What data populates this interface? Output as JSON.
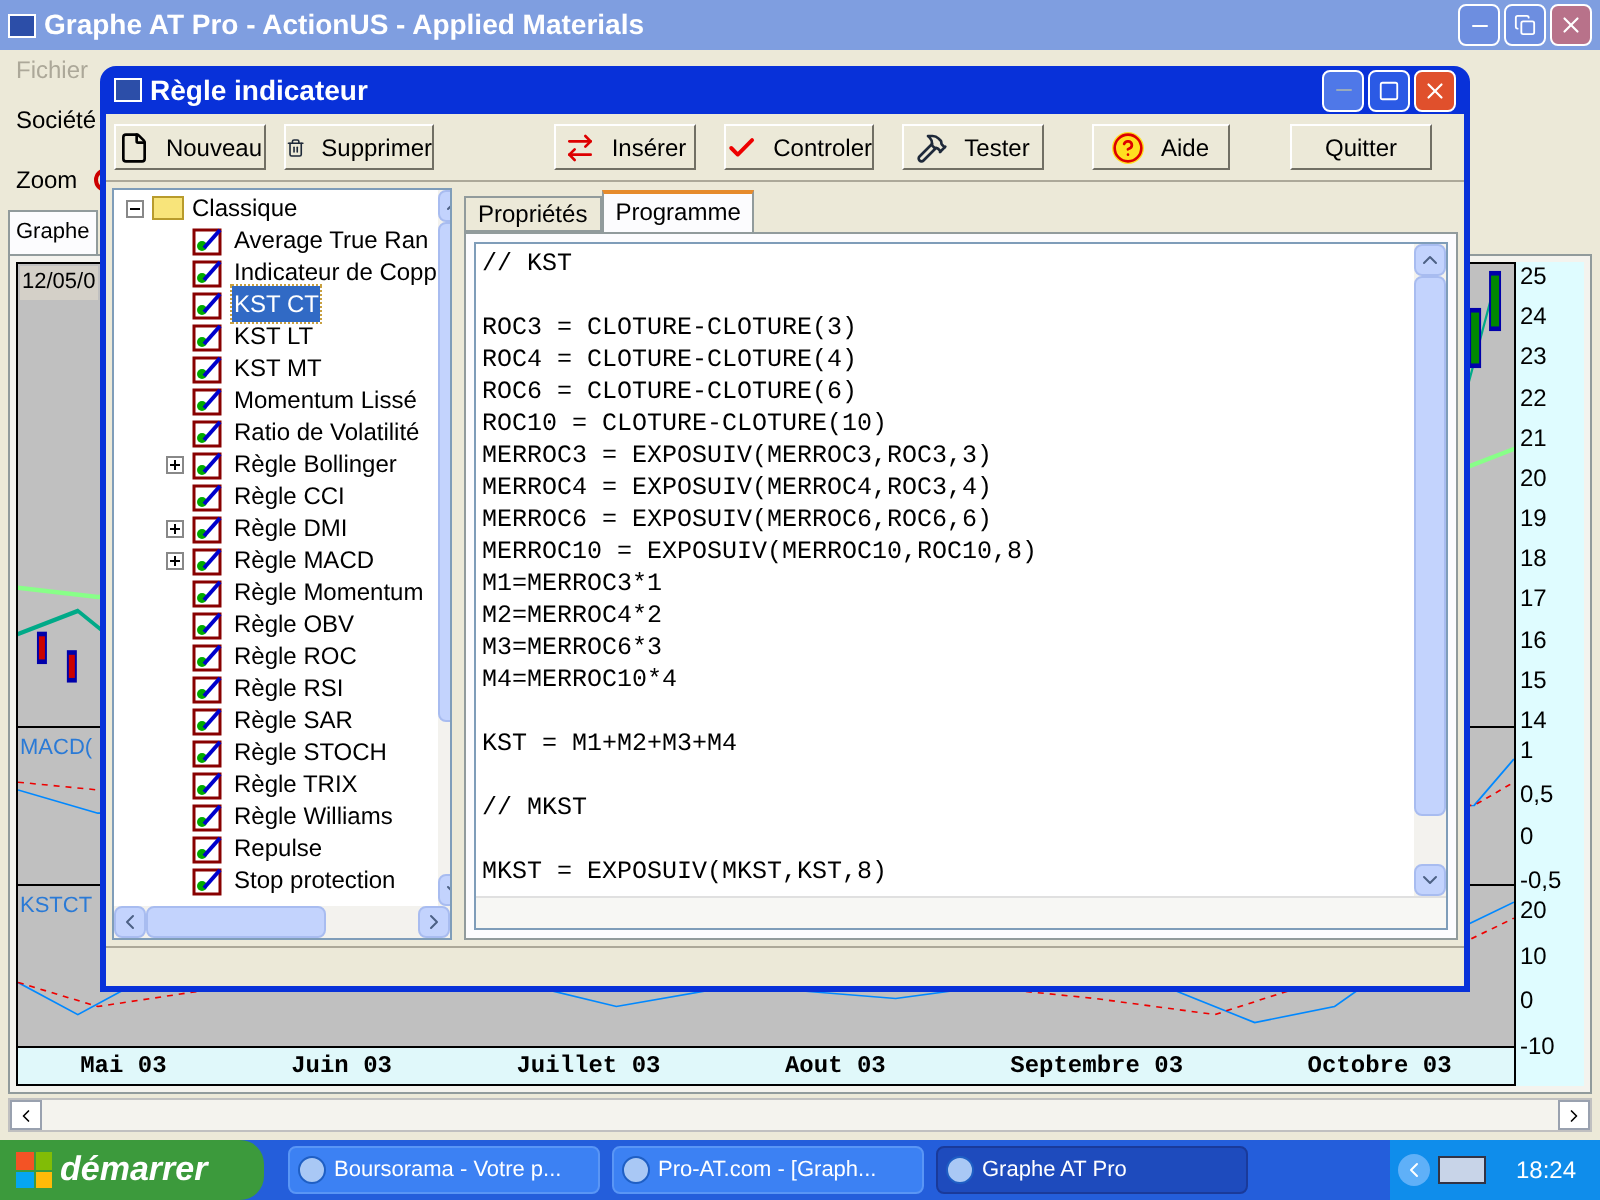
{
  "main_window": {
    "title": "Graphe AT Pro - ActionUS - Applied Materials",
    "menu": [
      "Fichier"
    ],
    "fields": [
      "Société",
      "Zoom"
    ],
    "tabs": [
      {
        "label": "Graphe",
        "selected": true
      }
    ],
    "chart": {
      "date": "12/05/0",
      "panels": [
        {
          "axis": [
            "25",
            "24",
            "23",
            "22",
            "21",
            "20",
            "19",
            "18",
            "17",
            "16",
            "15",
            "14"
          ]
        },
        {
          "label": "MACD(",
          "axis": [
            "1",
            "0,5",
            "0",
            "-0,5"
          ]
        },
        {
          "label": "KSTCT",
          "axis": [
            "20",
            "10",
            "0",
            "-10"
          ]
        }
      ],
      "months": [
        "Mai 03",
        "Juin 03",
        "Juillet 03",
        "Aout 03",
        "Septembre 03",
        "Octobre 03"
      ]
    }
  },
  "dialog": {
    "title": "Règle indicateur",
    "buttons": [
      {
        "label": "Nouveau",
        "kind": "new"
      },
      {
        "label": "Supprimer",
        "kind": "delete"
      },
      {
        "label": "Insérer",
        "kind": "insert"
      },
      {
        "label": "Controler",
        "kind": "check"
      },
      {
        "label": "Tester",
        "kind": "test"
      },
      {
        "label": "Aide",
        "kind": "help"
      },
      {
        "label": "Quitter",
        "kind": "plain"
      }
    ],
    "tree": {
      "label": "Classique",
      "expanded": true,
      "children": [
        {
          "label": "Average True Ran",
          "selected": false,
          "expandable": false
        },
        {
          "label": "Indicateur de Copp",
          "selected": false,
          "expandable": false
        },
        {
          "label": "KST CT",
          "selected": true,
          "expandable": false
        },
        {
          "label": "KST LT",
          "selected": false,
          "expandable": false
        },
        {
          "label": "KST MT",
          "selected": false,
          "expandable": false
        },
        {
          "label": "Momentum Lissé",
          "selected": false,
          "expandable": false
        },
        {
          "label": "Ratio de Volatilité",
          "selected": false,
          "expandable": false
        },
        {
          "label": "Règle Bollinger",
          "selected": false,
          "expandable": true
        },
        {
          "label": "Règle CCI",
          "selected": false,
          "expandable": false
        },
        {
          "label": "Règle DMI",
          "selected": false,
          "expandable": true
        },
        {
          "label": "Règle MACD",
          "selected": false,
          "expandable": true
        },
        {
          "label": "Règle Momentum",
          "selected": false,
          "expandable": false
        },
        {
          "label": "Règle OBV",
          "selected": false,
          "expandable": false
        },
        {
          "label": "Règle ROC",
          "selected": false,
          "expandable": false
        },
        {
          "label": "Règle RSI",
          "selected": false,
          "expandable": false
        },
        {
          "label": "Règle SAR",
          "selected": false,
          "expandable": false
        },
        {
          "label": "Règle STOCH",
          "selected": false,
          "expandable": false
        },
        {
          "label": "Règle TRIX",
          "selected": false,
          "expandable": false
        },
        {
          "label": "Règle Williams",
          "selected": false,
          "expandable": false
        },
        {
          "label": "Repulse",
          "selected": false,
          "expandable": false
        },
        {
          "label": "Stop protection",
          "selected": false,
          "expandable": false
        }
      ]
    },
    "tabs": [
      {
        "label": "Propriétés",
        "selected": false
      },
      {
        "label": "Programme",
        "selected": true
      }
    ],
    "code_blocks": [
      [
        "// KST"
      ],
      [
        "ROC3 = CLOTURE-CLOTURE(3)",
        "ROC4 = CLOTURE-CLOTURE(4)",
        "ROC6 = CLOTURE-CLOTURE(6)",
        "ROC10 = CLOTURE-CLOTURE(10)",
        "MERROC3 = EXPOSUIV(MERROC3,ROC3,3)",
        "MERROC4 = EXPOSUIV(MERROC4,ROC3,4)",
        "MERROC6 = EXPOSUIV(MERROC6,ROC6,6)",
        "MERROC10 = EXPOSUIV(MERROC10,ROC10,8)",
        "M1=MERROC3*1",
        "M2=MERROC4*2",
        "M3=MERROC6*3",
        "M4=MERROC10*4"
      ],
      [
        "KST = M1+M2+M3+M4"
      ],
      [
        "// MKST"
      ],
      [
        "MKST = EXPOSUIV(MKST,KST,8)"
      ]
    ]
  },
  "taskbar": {
    "start": "démarrer",
    "tasks": [
      {
        "label": "Boursorama - Votre p...",
        "selected": false
      },
      {
        "label": "Pro-AT.com - [Graph...",
        "selected": false
      },
      {
        "label": "Graphe AT Pro",
        "selected": true
      }
    ],
    "clock": "18:24"
  }
}
